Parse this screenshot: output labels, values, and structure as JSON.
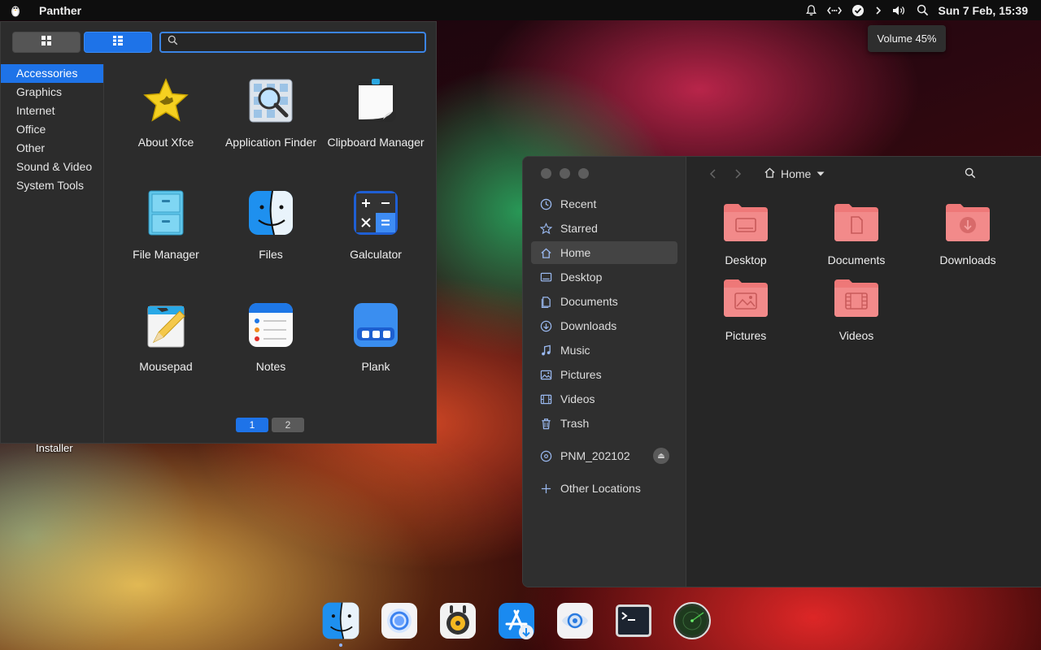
{
  "top_panel": {
    "app_title": "Panther",
    "clock": "Sun  7 Feb, 15:39",
    "tray_icons": [
      "bell-icon",
      "network-icon",
      "check-circle-icon",
      "chevron-right-icon",
      "volume-icon",
      "search-icon"
    ]
  },
  "tooltip": {
    "text": "Volume 45%"
  },
  "app_menu": {
    "search": {
      "value": "",
      "placeholder": ""
    },
    "categories": [
      "Accessories",
      "Graphics",
      "Internet",
      "Office",
      "Other",
      "Sound & Video",
      "System Tools"
    ],
    "selected_category": "Accessories",
    "apps": [
      {
        "label": "About Xfce",
        "icon": "star-icon"
      },
      {
        "label": "Application Finder",
        "icon": "app-finder-icon"
      },
      {
        "label": "Clipboard Manager",
        "icon": "clipboard-icon"
      },
      {
        "label": "File Manager",
        "icon": "file-cabinet-icon"
      },
      {
        "label": "Files",
        "icon": "finder-icon"
      },
      {
        "label": "Galculator",
        "icon": "calculator-icon"
      },
      {
        "label": "Mousepad",
        "icon": "notepad-pencil-icon"
      },
      {
        "label": "Notes",
        "icon": "notes-icon"
      },
      {
        "label": "Plank",
        "icon": "dock-icon"
      }
    ],
    "pages": [
      "1",
      "2"
    ],
    "active_page": "1"
  },
  "desktop": {
    "installer_label": "Installer"
  },
  "file_manager": {
    "places": [
      {
        "label": "Recent",
        "icon": "clock-icon"
      },
      {
        "label": "Starred",
        "icon": "star-outline-icon"
      },
      {
        "label": "Home",
        "icon": "home-icon"
      },
      {
        "label": "Desktop",
        "icon": "desktop-icon"
      },
      {
        "label": "Documents",
        "icon": "document-icon"
      },
      {
        "label": "Downloads",
        "icon": "download-icon"
      },
      {
        "label": "Music",
        "icon": "music-icon"
      },
      {
        "label": "Pictures",
        "icon": "picture-icon"
      },
      {
        "label": "Videos",
        "icon": "video-icon"
      },
      {
        "label": "Trash",
        "icon": "trash-icon"
      }
    ],
    "active_place": "Home",
    "device": {
      "label": "PNM_202102",
      "icon": "disc-icon"
    },
    "other_locations": {
      "label": "Other Locations",
      "icon": "plus-icon"
    },
    "path": {
      "label": "Home"
    },
    "folders": [
      {
        "label": "Desktop",
        "icon": "folder-desktop-icon"
      },
      {
        "label": "Documents",
        "icon": "folder-documents-icon"
      },
      {
        "label": "Downloads",
        "icon": "folder-downloads-icon"
      },
      {
        "label": "Pictures",
        "icon": "folder-pictures-icon"
      },
      {
        "label": "Videos",
        "icon": "folder-videos-icon"
      }
    ]
  },
  "dock": {
    "items": [
      "finder-icon",
      "browser-icon",
      "music-player-icon",
      "app-store-icon",
      "web-browser-icon",
      "terminal-icon",
      "radar-icon"
    ]
  },
  "colors": {
    "accent": "#1e73e8",
    "folder": "#ee7878",
    "panel": "#0e0e0e"
  }
}
